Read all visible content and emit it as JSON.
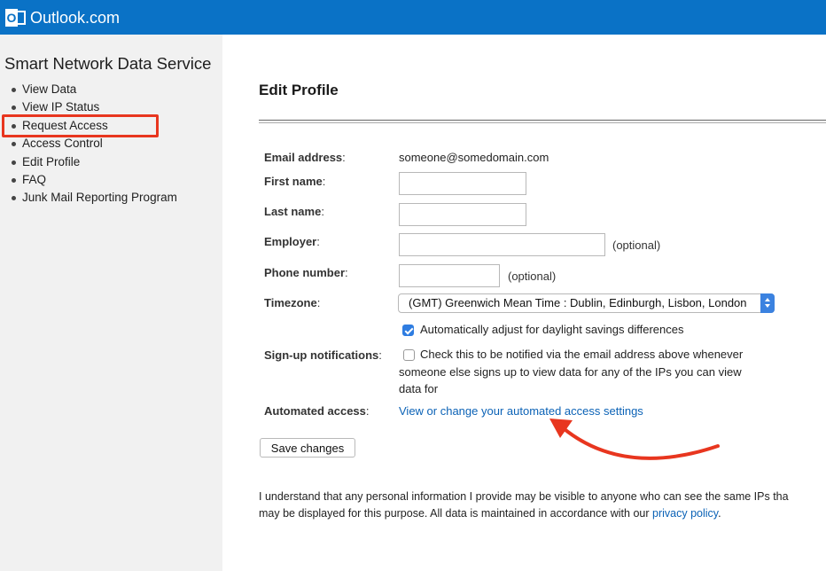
{
  "header": {
    "brand": "Outlook.com",
    "logo_letter": "O"
  },
  "sidebar": {
    "title": "Smart Network Data Service",
    "items": [
      {
        "label": "View Data"
      },
      {
        "label": "View IP Status"
      },
      {
        "label": "Request Access"
      },
      {
        "label": "Access Control"
      },
      {
        "label": "Edit Profile"
      },
      {
        "label": "FAQ"
      },
      {
        "label": "Junk Mail Reporting Program"
      }
    ]
  },
  "main": {
    "title": "Edit Profile",
    "form": {
      "email_label": "Email address",
      "email_value": "someone@somedomain.com",
      "first_name_label": "First name",
      "first_name_value": "",
      "last_name_label": "Last name",
      "last_name_value": "",
      "employer_label": "Employer",
      "employer_value": "",
      "employer_hint": "(optional)",
      "phone_label": "Phone number",
      "phone_value": "",
      "phone_hint": "(optional)",
      "timezone_label": "Timezone",
      "timezone_selected": "(GMT) Greenwich Mean Time : Dublin, Edinburgh, Lisbon, London",
      "dst_label": "Automatically adjust for daylight savings differences",
      "dst_checked": true,
      "signup_label": "Sign-up notifications",
      "signup_text_line1": "Check this to be notified via the email address above whenever",
      "signup_text_line2": "someone else signs up to view data for any of the IPs you can view",
      "signup_text_line3": "data for",
      "signup_checked": false,
      "automated_label": "Automated access",
      "automated_link": "View or change your automated access settings",
      "save_label": "Save changes",
      "colon": ":"
    },
    "footer": {
      "line1": "I understand that any personal information I provide may be visible to anyone who can see the same IPs tha",
      "line2_prefix": "may be displayed for this purpose. All data is maintained in accordance with our ",
      "privacy_link": "privacy policy",
      "line2_suffix": "."
    }
  },
  "colors": {
    "header_bg": "#0a72c6",
    "sidebar_bg": "#f1f1f1",
    "highlight": "#e8361f",
    "link": "#0b62b6",
    "checkbox": "#2f7de1"
  },
  "icons": [
    "outlook-logo-icon",
    "bullet-icon",
    "checkmark-icon",
    "select-stepper-icon",
    "annotation-arrow"
  ]
}
